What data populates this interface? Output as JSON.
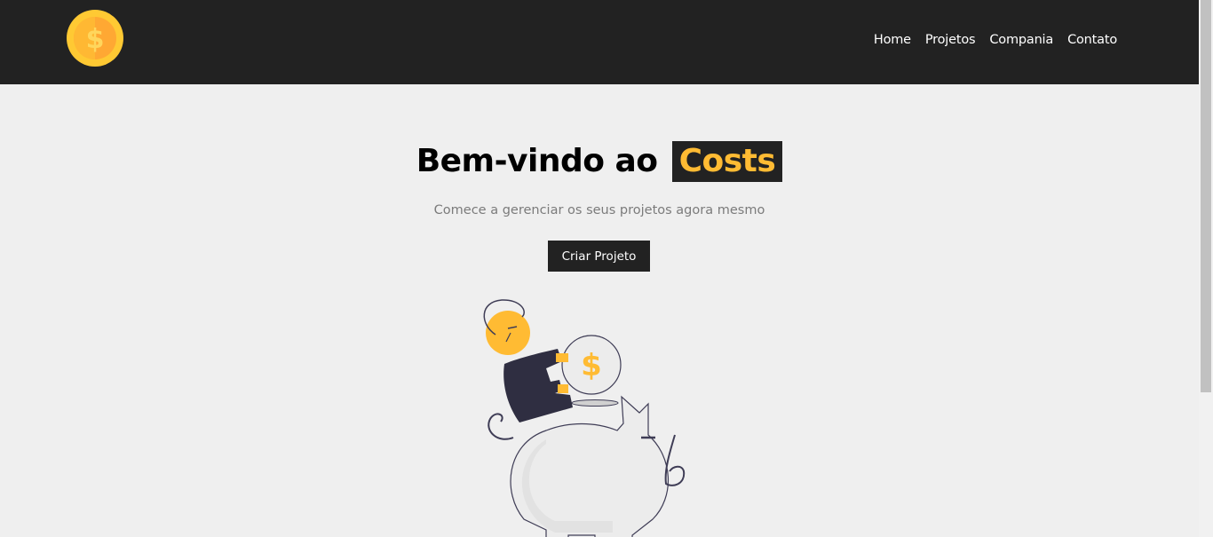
{
  "navbar": {
    "logo_icon": "coin-dollar-icon",
    "links": [
      {
        "label": "Home"
      },
      {
        "label": "Projetos"
      },
      {
        "label": "Compania"
      },
      {
        "label": "Contato"
      }
    ]
  },
  "home": {
    "title_prefix": "Bem-vindo ao",
    "title_highlight": "Costs",
    "subtitle": "Comece a gerenciar os seus projetos agora mesmo",
    "cta_label": "Criar Projeto",
    "illustration": "piggy-bank-savings-illustration",
    "illustration_coin_symbol": "$"
  },
  "colors": {
    "navbar_bg": "#222222",
    "page_bg": "#efefef",
    "accent": "#ffbb33",
    "text_muted": "#7b7b7b"
  }
}
